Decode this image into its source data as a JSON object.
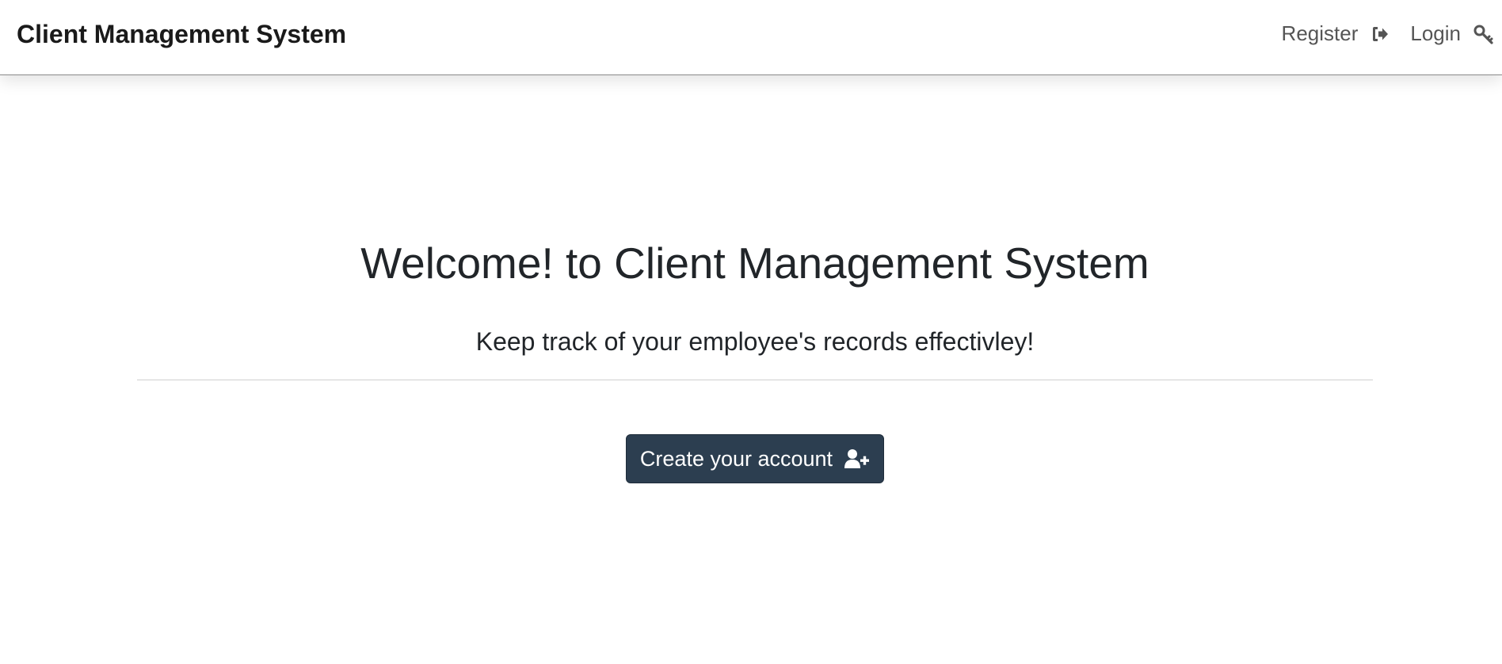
{
  "navbar": {
    "brand": "Client Management System",
    "links": [
      {
        "label": "Register",
        "icon": "sign-in-icon"
      },
      {
        "label": "Login",
        "icon": "key-icon"
      }
    ]
  },
  "hero": {
    "title": "Welcome! to Client Management System",
    "subtitle": "Keep track of your employee's records effectivley!",
    "cta_label": "Create your account",
    "cta_icon": "user-plus-icon"
  },
  "colors": {
    "button_bg": "#2c3e50",
    "text": "#212529",
    "nav_link": "#555555"
  }
}
